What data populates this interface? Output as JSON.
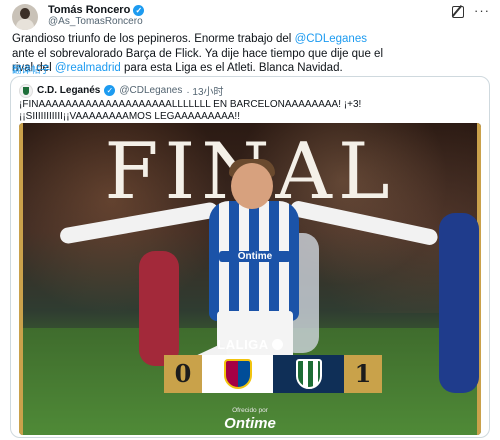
{
  "tweet": {
    "author_name": "Tomás Roncero",
    "author_handle": "@As_TomasRoncero",
    "text_line1_pre": "Grandioso triunfo de los pepineros. Enorme trabajo del ",
    "text_line1_mention": "@CDLeganes",
    "text_line2": "ante el sobrevalorado Barça de Flick. Ya dije hace tiempo que dije que el",
    "text_line3_pre": "rival del ",
    "text_line3_mention": "@realmadrid",
    "text_line3_post": " para esta Liga es el Atleti. Blanca Navidad.",
    "translate_label": "翻译帖子"
  },
  "quoted": {
    "author_name": "C.D. Leganés",
    "author_handle": "@CDLeganes",
    "time": "· 13小时",
    "text_line1": "¡FINAAAAAAAAAAAAAAAAAAAALLLLLLL EN BARCELONAAAAAAAA! ¡+3!",
    "text_line2": "¡¡SIIIIIIIIIII¡¡VAAAAAAAAMOS LEGAAAAAAAAA!!"
  },
  "media": {
    "headline": "FINAL",
    "sponsor_shirt": "Ontime",
    "league": "LALIGA",
    "home_score": "0",
    "away_score": "1",
    "offered_by": "Ofrecido por",
    "brand": "Ontime"
  },
  "colors": {
    "accent_link": "#1d9bf0",
    "gold": "#c9a24a",
    "verified": "#1d9bf0"
  },
  "icons": {
    "verified": "verified-badge-icon",
    "grok": "grok-icon",
    "more": "more-icon"
  }
}
